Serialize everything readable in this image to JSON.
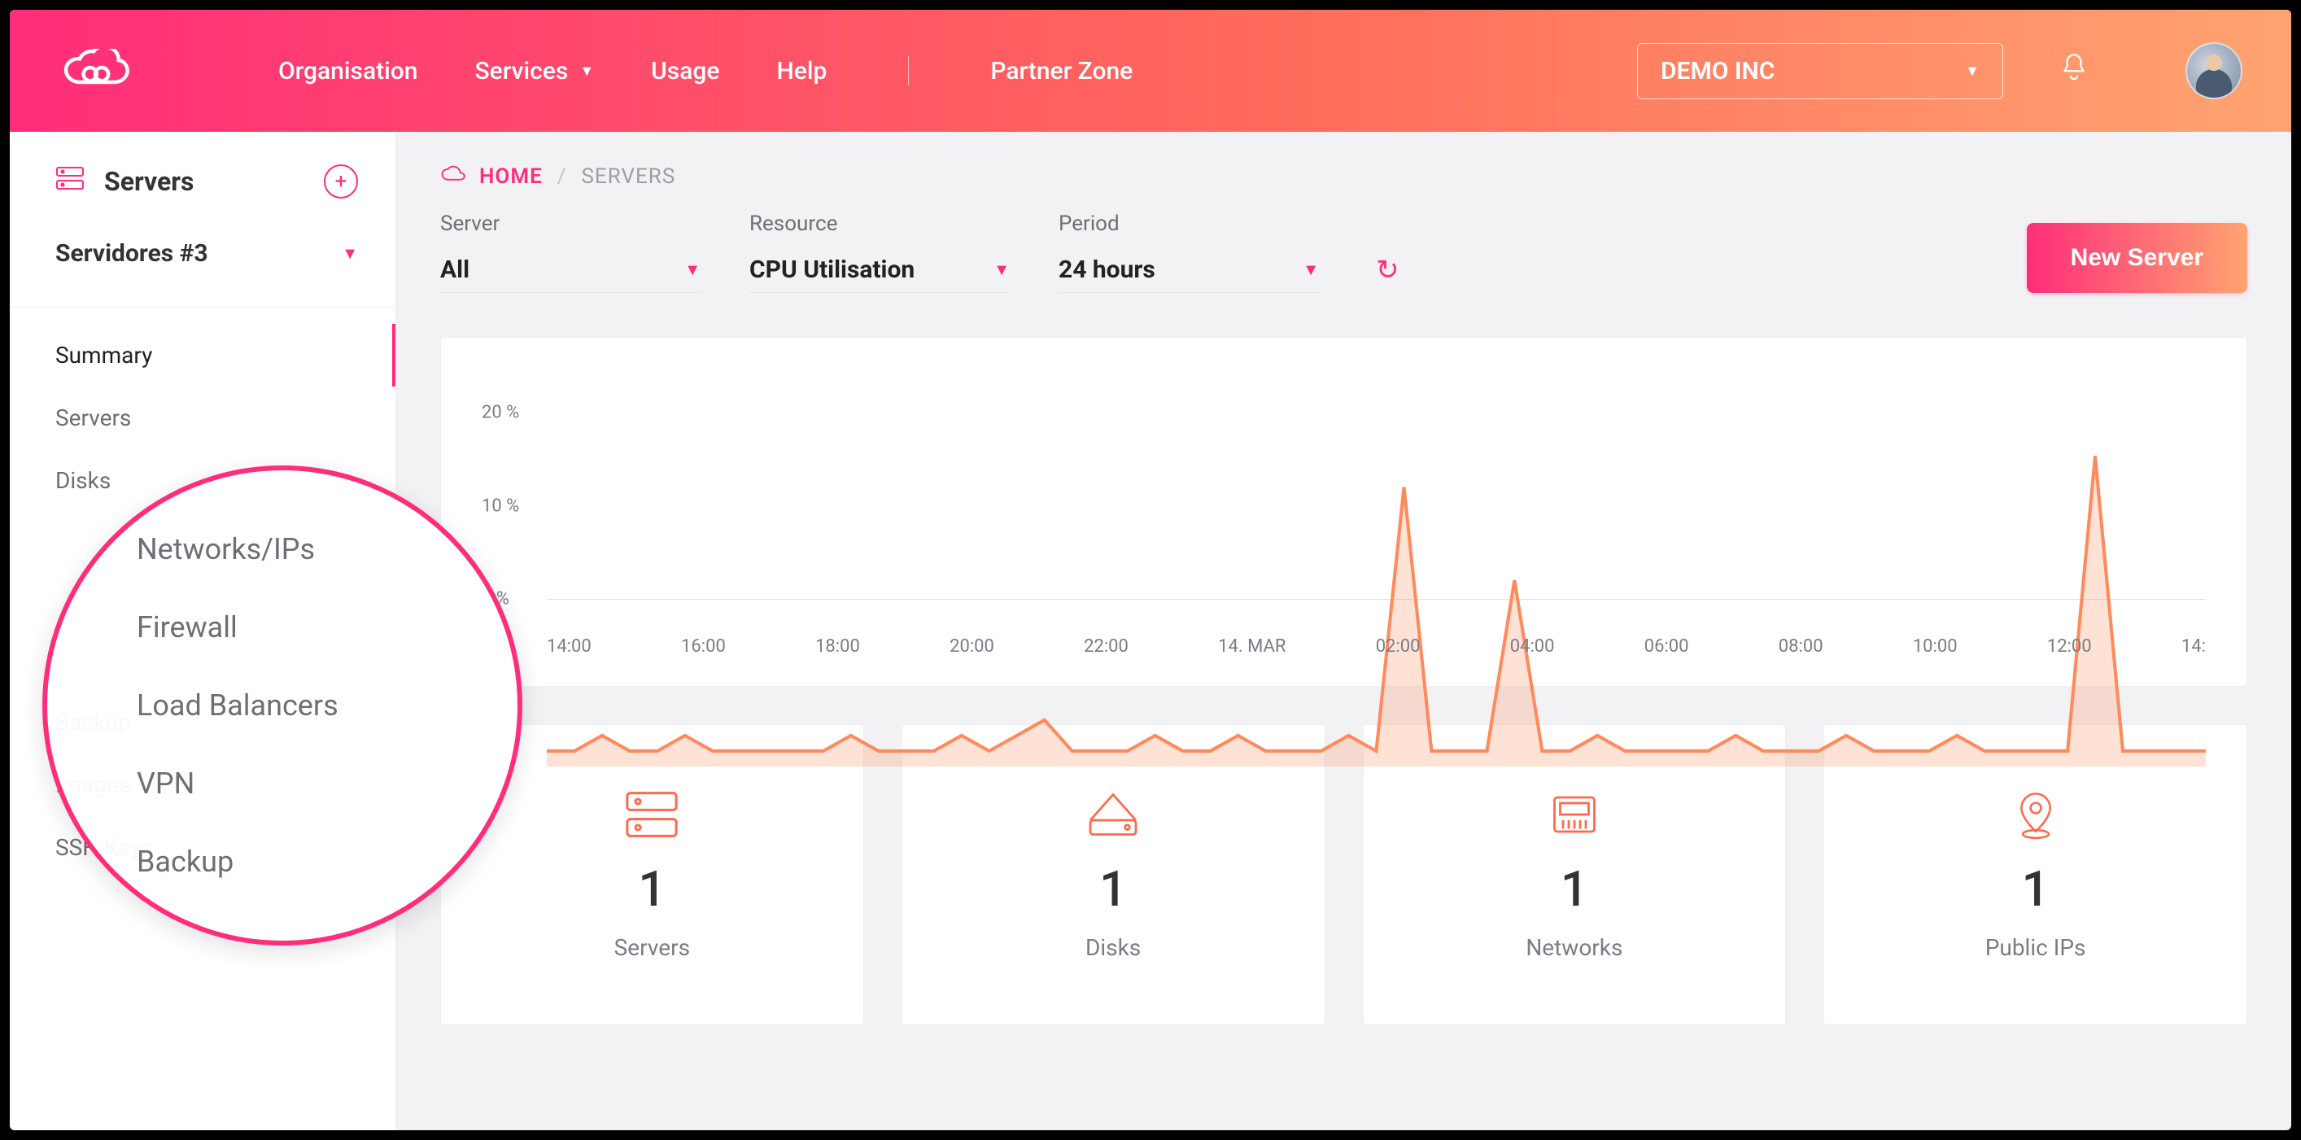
{
  "header": {
    "nav": {
      "organisation": "Organisation",
      "services": "Services",
      "usage": "Usage",
      "help": "Help",
      "partner": "Partner Zone"
    },
    "org_selected": "DEMO INC"
  },
  "sidebar": {
    "title": "Servers",
    "group_selected": "Servidores #3",
    "items": [
      {
        "label": "Summary",
        "active": true
      },
      {
        "label": "Servers"
      },
      {
        "label": "Disks"
      },
      {
        "label": "Backup"
      },
      {
        "label": "Images"
      },
      {
        "label": "SSH Keys"
      }
    ]
  },
  "zoom_menu": {
    "items": [
      "Networks/IPs",
      "Firewall",
      "Load Balancers",
      "VPN",
      "Backup"
    ]
  },
  "breadcrumb": {
    "home": "HOME",
    "current": "SERVERS"
  },
  "filters": {
    "server": {
      "label": "Server",
      "value": "All"
    },
    "resource": {
      "label": "Resource",
      "value": "CPU Utilisation"
    },
    "period": {
      "label": "Period",
      "value": "24 hours"
    }
  },
  "actions": {
    "new_server": "New Server"
  },
  "chart_data": {
    "type": "line",
    "title": "",
    "xlabel": "",
    "ylabel": "",
    "ylim": [
      0,
      25
    ],
    "y_ticks": [
      "20 %",
      "10 %",
      "0 %"
    ],
    "x_ticks": [
      "14:00",
      "16:00",
      "18:00",
      "20:00",
      "22:00",
      "14. MAR",
      "02:00",
      "04:00",
      "06:00",
      "08:00",
      "10:00",
      "12:00",
      "14:"
    ],
    "series": [
      {
        "name": "CPU Utilisation",
        "color": "#ff8a5c",
        "values": [
          1,
          1,
          2,
          1,
          1,
          2,
          1,
          1,
          1,
          1,
          1,
          2,
          1,
          1,
          1,
          2,
          1,
          2,
          3,
          1,
          1,
          1,
          2,
          1,
          1,
          2,
          1,
          1,
          1,
          2,
          1,
          18,
          1,
          1,
          1,
          12,
          1,
          1,
          2,
          1,
          1,
          1,
          1,
          2,
          1,
          1,
          1,
          2,
          1,
          1,
          1,
          2,
          1,
          1,
          1,
          1,
          20,
          1,
          1,
          1,
          1
        ]
      }
    ]
  },
  "stats": [
    {
      "icon": "servers-icon",
      "value": "1",
      "label": "Servers"
    },
    {
      "icon": "disks-icon",
      "value": "1",
      "label": "Disks"
    },
    {
      "icon": "networks-icon",
      "value": "1",
      "label": "Networks"
    },
    {
      "icon": "public-ips-icon",
      "value": "1",
      "label": "Public IPs"
    }
  ]
}
